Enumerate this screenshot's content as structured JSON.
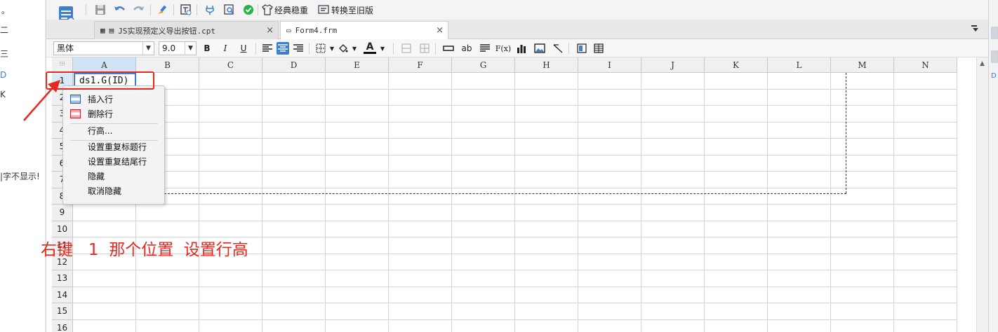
{
  "left_panel": {
    "fragments": [
      "。",
      "二",
      "三",
      "D",
      "K"
    ],
    "cut_text": "|字不显示!"
  },
  "right_panel": {
    "fragments": [
      "D"
    ]
  },
  "toolbar": {
    "items": [
      {
        "name": "save-button",
        "icon": "save-icon",
        "glyph": "🖫"
      },
      {
        "name": "undo-button",
        "icon": "undo-icon",
        "glyph": "↶"
      },
      {
        "name": "redo-button",
        "icon": "redo-icon",
        "glyph": "↷"
      },
      {
        "name": "format-brush-button",
        "icon": "brush-icon",
        "glyph": "🖌"
      },
      {
        "name": "template-button",
        "icon": "template-icon",
        "glyph": "⊡"
      },
      {
        "name": "connect-button",
        "icon": "plug-icon",
        "glyph": "⌁"
      },
      {
        "name": "preview-button",
        "icon": "preview-icon",
        "glyph": "⌕"
      },
      {
        "name": "check-button",
        "icon": "check-icon",
        "glyph": "✔"
      }
    ],
    "classic_label": "经典稳重",
    "convert_label": "转换至旧版"
  },
  "tabs": [
    {
      "label": "JS实现预定义导出按钮.cpt",
      "active": false,
      "close": "×"
    },
    {
      "label": "Form4.frm",
      "active": true,
      "close": "×"
    }
  ],
  "format_bar": {
    "font_name": "黑体",
    "font_size": "9.0",
    "bold": "B",
    "italic": "I",
    "underline": "U",
    "text_color": "A",
    "text_btn": "ab",
    "formula_btn": "F(x)"
  },
  "sheet": {
    "columns": [
      "A",
      "B",
      "C",
      "D",
      "E",
      "F",
      "G",
      "H",
      "I",
      "J",
      "K",
      "L",
      "M",
      "N"
    ],
    "rows": [
      "1",
      "2",
      "3",
      "4",
      "5",
      "6",
      "7",
      "8",
      "9",
      "10",
      "11",
      "12",
      "13",
      "14",
      "15",
      "16"
    ],
    "cell_a1": "ds1.G(ID)",
    "selected_column": "A",
    "selected_row": "1"
  },
  "context_menu": {
    "items": [
      {
        "label": "插入行",
        "icon": "insert-row-icon"
      },
      {
        "label": "删除行",
        "icon": "delete-row-icon"
      },
      {
        "label": "行高..."
      },
      {
        "label": "设置重复标题行"
      },
      {
        "label": "设置重复结尾行"
      },
      {
        "label": "隐藏"
      },
      {
        "label": "取消隐藏"
      }
    ]
  },
  "annotation": {
    "text": "右键   1  那个位置  设置行高",
    "color": "#e8281e"
  },
  "colors": {
    "accent": "#3d7fd3",
    "annotation_red": "#e8281e"
  }
}
